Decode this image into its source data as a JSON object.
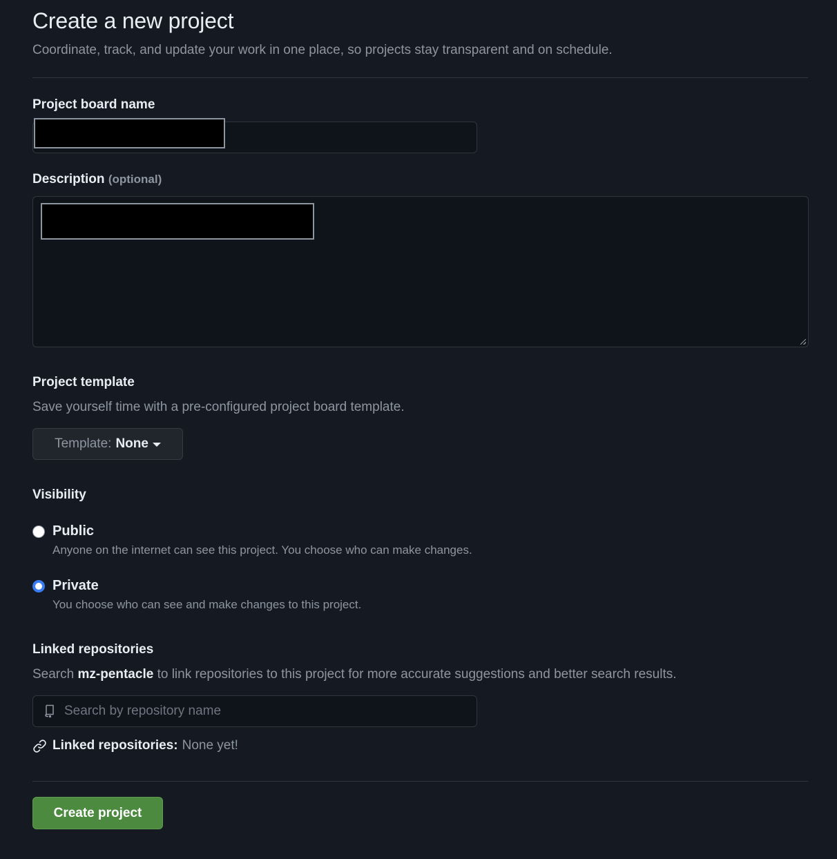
{
  "header": {
    "title": "Create a new project",
    "subtitle": "Coordinate, track, and update your work in one place, so projects stay transparent and on schedule."
  },
  "name_field": {
    "label": "Project board name",
    "value": "[redacted]"
  },
  "description_field": {
    "label": "Description",
    "optional": "(optional)",
    "value": "[redacted]"
  },
  "template": {
    "label": "Project template",
    "help": "Save yourself time with a pre-configured project board template.",
    "button_prefix": "Template:",
    "button_value": "None"
  },
  "visibility": {
    "label": "Visibility",
    "options": [
      {
        "title": "Public",
        "description": "Anyone on the internet can see this project. You choose who can make changes.",
        "checked": false
      },
      {
        "title": "Private",
        "description": "You choose who can see and make changes to this project.",
        "checked": true
      }
    ]
  },
  "linked_repos": {
    "label": "Linked repositories",
    "help_prefix": "Search",
    "owner": "mz-pentacle",
    "help_suffix": "to link repositories to this project for more accurate suggestions and better search results.",
    "search_placeholder": "Search by repository name",
    "status_label": "Linked repositories:",
    "status_value": "None yet!"
  },
  "actions": {
    "create_label": "Create project"
  },
  "colors": {
    "background": "#151a22",
    "primary_button": "#4c8a3f",
    "radio_accent": "#3b7bf0"
  }
}
